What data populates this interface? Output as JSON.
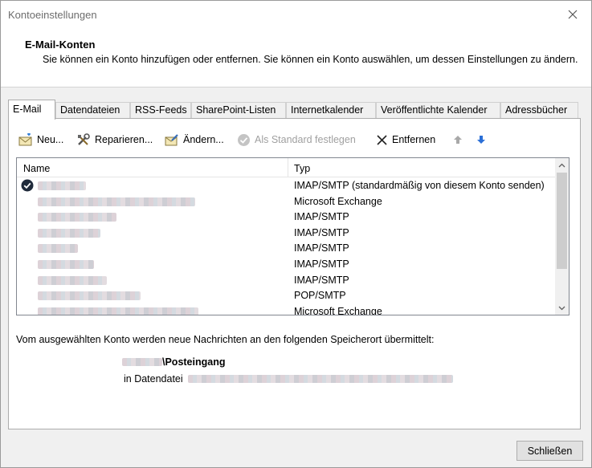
{
  "window": {
    "title": "Kontoeinstellungen"
  },
  "header": {
    "title": "E-Mail-Konten",
    "description": "Sie können ein Konto hinzufügen oder entfernen. Sie können ein Konto auswählen, um dessen Einstellungen zu ändern."
  },
  "tabs": [
    {
      "label": "E-Mail",
      "active": true
    },
    {
      "label": "Datendateien"
    },
    {
      "label": "RSS-Feeds"
    },
    {
      "label": "SharePoint-Listen"
    },
    {
      "label": "Internetkalender"
    },
    {
      "label": "Veröffentlichte Kalender"
    },
    {
      "label": "Adressbücher"
    }
  ],
  "toolbar": {
    "new_label": "Neu...",
    "repair_label": "Reparieren...",
    "change_label": "Ändern...",
    "default_label": "Als Standard festlegen",
    "remove_label": "Entfernen"
  },
  "list": {
    "col_name": "Name",
    "col_type": "Typ",
    "rows": [
      {
        "type": "IMAP/SMTP (standardmäßig von diesem Konto senden)",
        "default": true
      },
      {
        "type": "Microsoft Exchange"
      },
      {
        "type": "IMAP/SMTP"
      },
      {
        "type": "IMAP/SMTP"
      },
      {
        "type": "IMAP/SMTP"
      },
      {
        "type": "IMAP/SMTP"
      },
      {
        "type": "IMAP/SMTP"
      },
      {
        "type": "POP/SMTP"
      },
      {
        "type": "Microsoft Exchange"
      }
    ]
  },
  "delivery": {
    "info": "Vom ausgewählten Konto werden neue Nachrichten an den folgenden Speicherort übermittelt:",
    "folder": "\\Posteingang",
    "datafile_prefix": "in Datendatei"
  },
  "footer": {
    "close_label": "Schließen"
  }
}
